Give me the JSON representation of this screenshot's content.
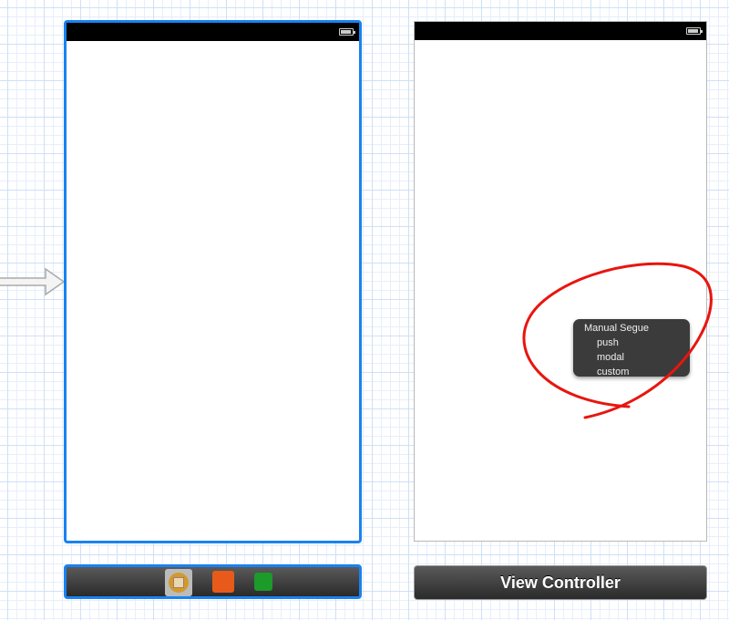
{
  "scene1": {
    "name": "initial-view-controller"
  },
  "scene2": {
    "dock_label": "View Controller"
  },
  "dock1": {
    "icons": [
      "view-controller-icon",
      "first-responder-icon",
      "exit-icon"
    ]
  },
  "popup": {
    "title": "Manual Segue",
    "items": [
      "push",
      "modal",
      "custom"
    ]
  },
  "colors": {
    "selection": "#1a82f0",
    "annotation": "#e8150f"
  }
}
